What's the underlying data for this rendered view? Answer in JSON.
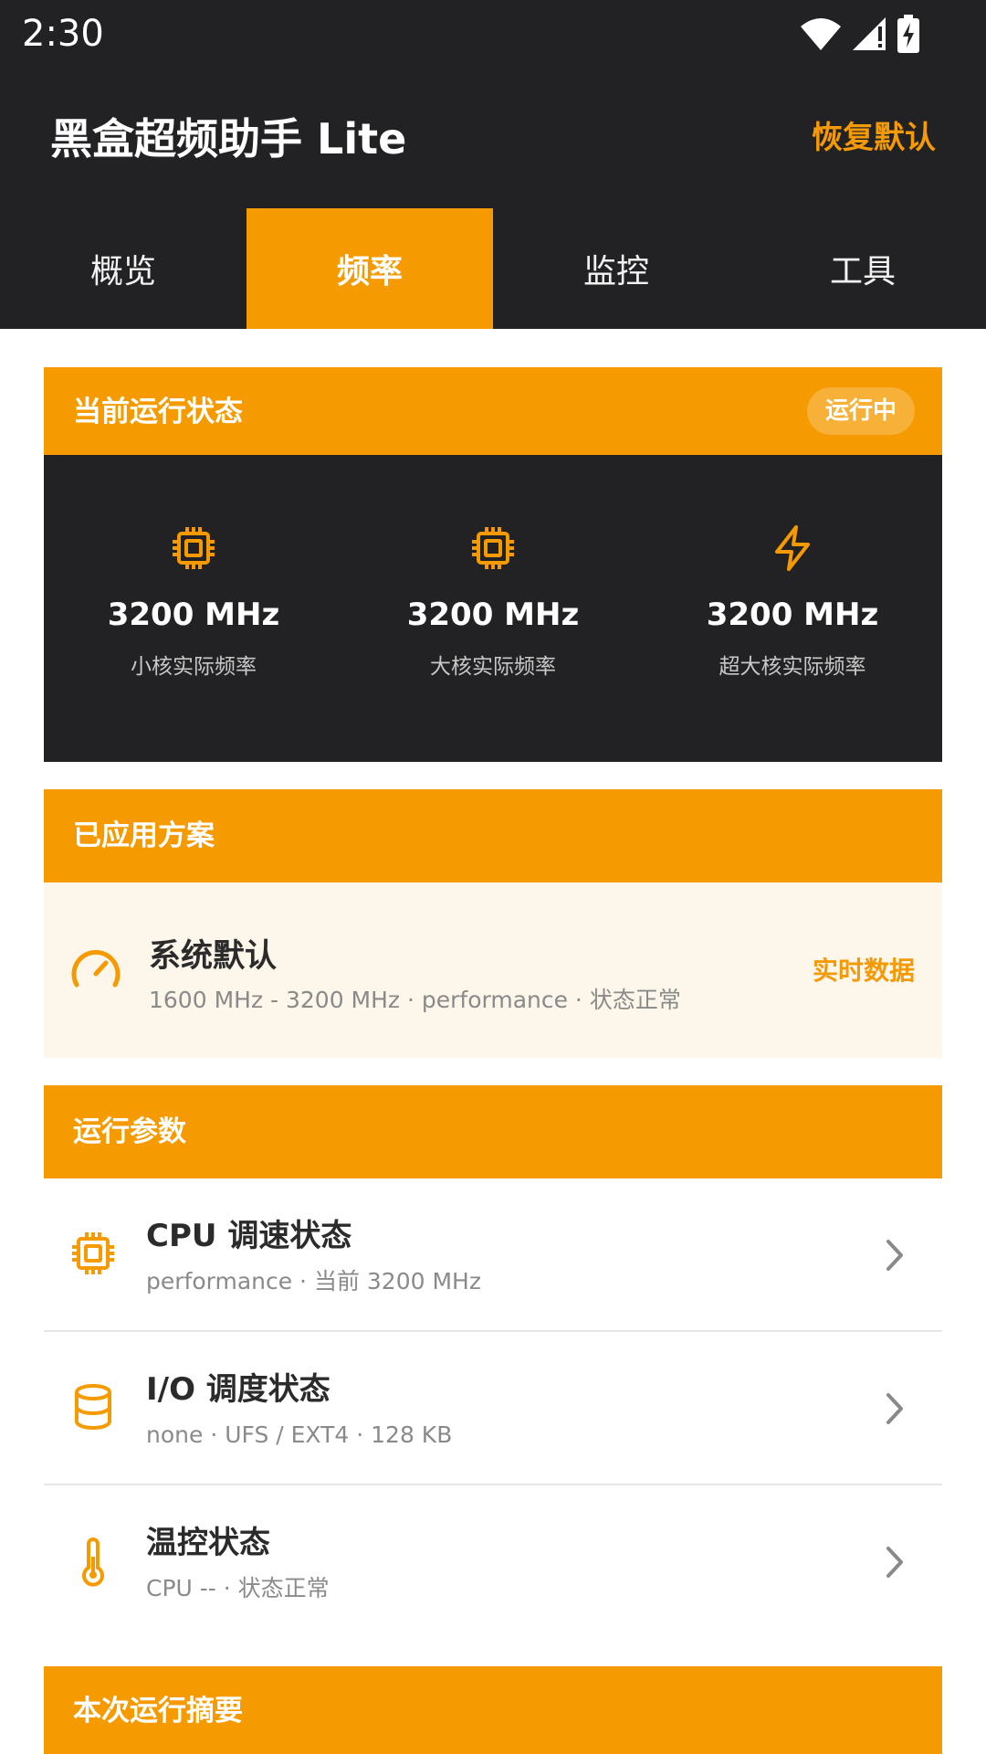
{
  "status_bar": {
    "time": "2:30"
  },
  "app_bar": {
    "title": "黑盒超频助手 Lite",
    "restore_label": "恢复默认"
  },
  "tabs": [
    {
      "label": "概览",
      "active": false
    },
    {
      "label": "频率",
      "active": true
    },
    {
      "label": "监控",
      "active": false
    },
    {
      "label": "工具",
      "active": false
    }
  ],
  "status_card": {
    "title": "当前运行状态",
    "badge": "运行中",
    "cores": [
      {
        "value": "3200 MHz",
        "label": "小核实际频率",
        "icon": "chip-icon"
      },
      {
        "value": "3200 MHz",
        "label": "大核实际频率",
        "icon": "chip-icon"
      },
      {
        "value": "3200 MHz",
        "label": "超大核实际频率",
        "icon": "bolt-icon"
      }
    ]
  },
  "plan_card": {
    "title": "已应用方案",
    "name": "系统默认",
    "detail": "1600 MHz - 3200 MHz · performance · 状态正常",
    "link_label": "实时数据",
    "icon": "speedometer-icon"
  },
  "params_card": {
    "title": "运行参数",
    "rows": [
      {
        "title": "CPU 调速状态",
        "sub": "performance · 当前 3200 MHz",
        "icon": "chip-icon"
      },
      {
        "title": "I/O 调度状态",
        "sub": "none · UFS / EXT4 · 128 KB",
        "icon": "database-icon"
      },
      {
        "title": "温控状态",
        "sub": "CPU -- · 状态正常",
        "icon": "thermometer-icon"
      }
    ]
  },
  "summary_card": {
    "title": "本次运行摘要"
  },
  "colors": {
    "accent": "#f59a00",
    "dark": "#222224",
    "plan_bg": "#fdf6ea"
  }
}
